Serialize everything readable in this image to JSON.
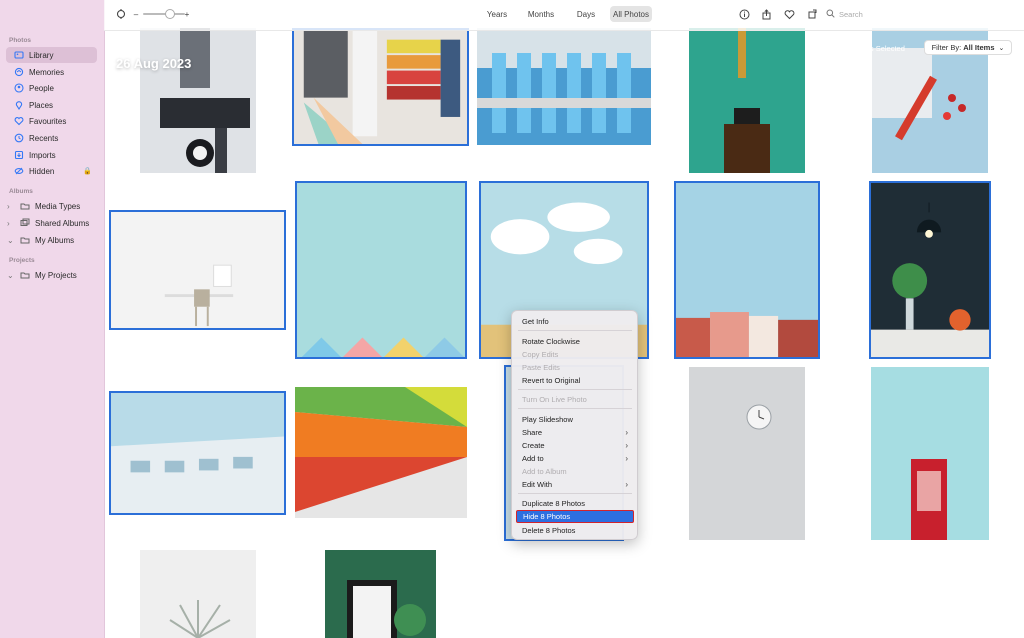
{
  "sidebar": {
    "section_photos": "Photos",
    "section_albums": "Albums",
    "section_projects": "Projects",
    "items": [
      {
        "label": "Library"
      },
      {
        "label": "Memories"
      },
      {
        "label": "People"
      },
      {
        "label": "Places"
      },
      {
        "label": "Favourites"
      },
      {
        "label": "Recents"
      },
      {
        "label": "Imports"
      },
      {
        "label": "Hidden"
      }
    ],
    "albums": [
      {
        "label": "Media Types"
      },
      {
        "label": "Shared Albums"
      },
      {
        "label": "My Albums"
      }
    ],
    "projects": [
      {
        "label": "My Projects"
      }
    ]
  },
  "toolbar": {
    "minus": "–",
    "plus": "+",
    "tabs": [
      "Years",
      "Months",
      "Days",
      "All Photos"
    ],
    "search_placeholder": "Search"
  },
  "header": {
    "date": "26 Aug 2023",
    "selected": "8 Photos Selected",
    "filter_prefix": "Filter By: ",
    "filter_value": "All Items"
  },
  "menu": {
    "items": [
      "Get Info",
      "Rotate Clockwise",
      "Copy Edits",
      "Paste Edits",
      "Revert to Original",
      "Turn On Live Photo",
      "Play Slideshow",
      "Share",
      "Create",
      "Add to",
      "Add to Album",
      "Edit With",
      "Duplicate 8 Photos",
      "Hide 8 Photos",
      "Delete 8 Photos"
    ]
  },
  "colors": {
    "sidebar_bg": "#f0d8ea",
    "selection": "#2b6fd8",
    "menu_highlight": "#2d6fe0",
    "highlight_outline": "#d3232c"
  }
}
